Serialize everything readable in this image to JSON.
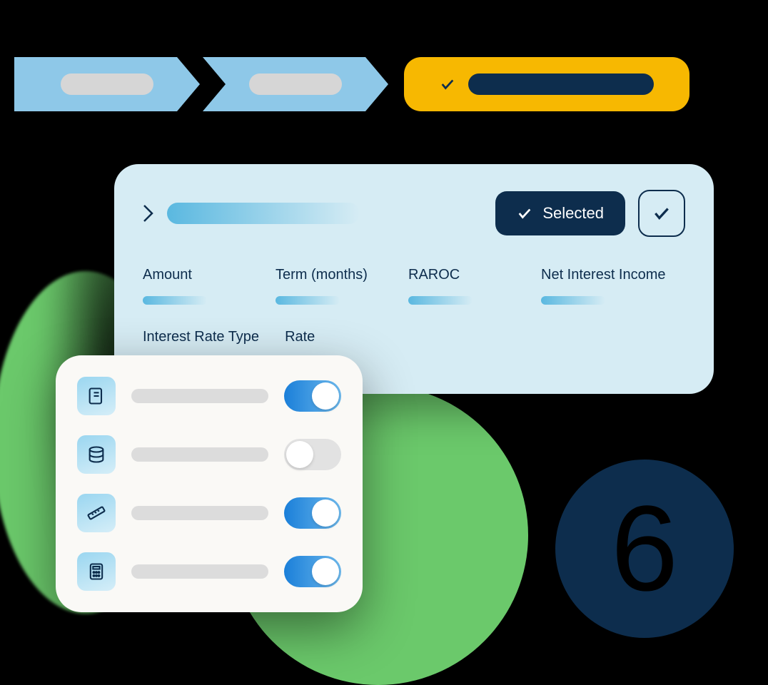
{
  "progress": {
    "steps_count": 2,
    "status_color": "#f7b801"
  },
  "card": {
    "selected_label": "Selected",
    "metrics": [
      {
        "label": "Amount",
        "has_bar": true
      },
      {
        "label": "Term (months)",
        "has_bar": true
      },
      {
        "label": "RAROC",
        "has_bar": true
      },
      {
        "label": "Net Interest Income",
        "has_bar": true
      }
    ],
    "metrics_row2": [
      {
        "label": "Interest Rate Type",
        "has_bar": false
      },
      {
        "label": "Rate",
        "has_bar": false
      }
    ]
  },
  "toggles": [
    {
      "icon": "scroll-icon",
      "state": "on"
    },
    {
      "icon": "database-icon",
      "state": "off"
    },
    {
      "icon": "ruler-icon",
      "state": "on"
    },
    {
      "icon": "calculator-icon",
      "state": "on"
    }
  ],
  "badge": {
    "number": "6"
  },
  "colors": {
    "primary_dark": "#0d2d4d",
    "light_blue": "#8ec8e8",
    "card_bg": "#d6ecf4",
    "green": "#6bc96b",
    "yellow": "#f7b801"
  }
}
